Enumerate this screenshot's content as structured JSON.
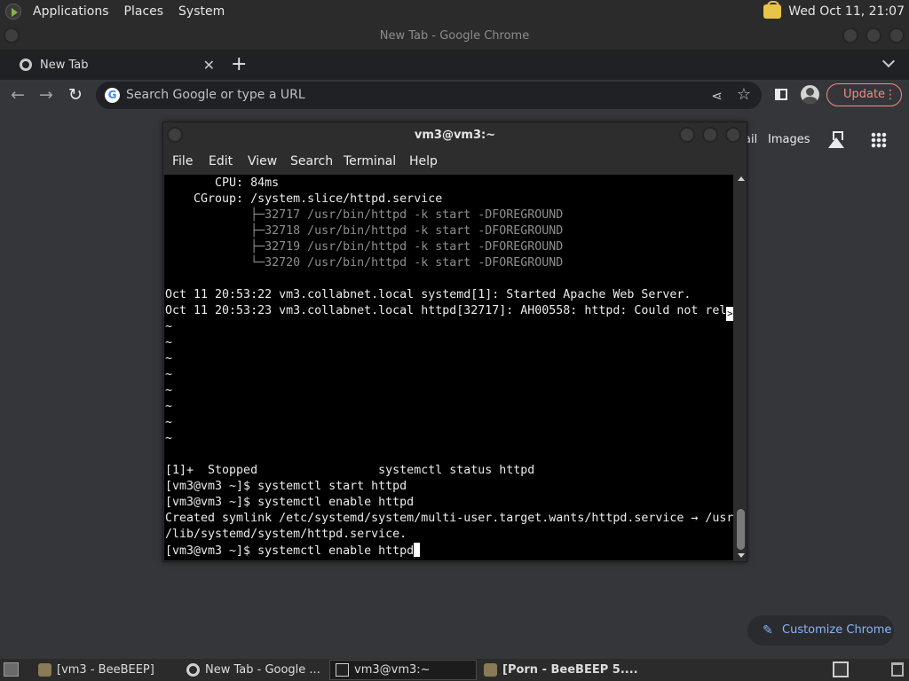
{
  "top_panel": {
    "menus": [
      "Applications",
      "Places",
      "System"
    ],
    "clock": "Wed Oct 11, 21:07"
  },
  "chrome": {
    "window_title": "New Tab - Google Chrome",
    "tab_label": "New Tab",
    "omnibox_placeholder": "Search Google or type a URL",
    "update_label": "Update",
    "gmail_label": "ail",
    "images_label": "Images",
    "customize_label": "Customize Chrome"
  },
  "terminal": {
    "title": "vm3@vm3:~",
    "menus": [
      "File",
      "Edit",
      "View",
      "Search",
      "Terminal",
      "Help"
    ],
    "lines": [
      {
        "text": "       CPU: 84ms",
        "dim": false
      },
      {
        "text": "    CGroup: /system.slice/httpd.service",
        "dim": false
      },
      {
        "text": "            ├─32717 /usr/bin/httpd -k start -DFOREGROUND",
        "dim": true
      },
      {
        "text": "            ├─32718 /usr/bin/httpd -k start -DFOREGROUND",
        "dim": true
      },
      {
        "text": "            ├─32719 /usr/bin/httpd -k start -DFOREGROUND",
        "dim": true
      },
      {
        "text": "            └─32720 /usr/bin/httpd -k start -DFOREGROUND",
        "dim": true
      },
      {
        "text": "",
        "dim": false
      },
      {
        "text": "Oct 11 20:53:22 vm3.collabnet.local systemd[1]: Started Apache Web Server.",
        "dim": false
      },
      {
        "text": "Oct 11 20:53:23 vm3.collabnet.local httpd[32717]: AH00558: httpd: Could not rel",
        "dim": false,
        "truncated": true
      },
      {
        "text": "~",
        "dim": false
      },
      {
        "text": "~",
        "dim": false
      },
      {
        "text": "~",
        "dim": false
      },
      {
        "text": "~",
        "dim": false
      },
      {
        "text": "~",
        "dim": false
      },
      {
        "text": "~",
        "dim": false
      },
      {
        "text": "~",
        "dim": false
      },
      {
        "text": "~",
        "dim": false
      },
      {
        "text": "",
        "dim": false
      },
      {
        "text": "[1]+  Stopped                 systemctl status httpd",
        "dim": false
      },
      {
        "text": "[vm3@vm3 ~]$ systemctl start httpd",
        "dim": false
      },
      {
        "text": "[vm3@vm3 ~]$ systemctl enable httpd",
        "dim": false
      },
      {
        "text": "Created symlink /etc/systemd/system/multi-user.target.wants/httpd.service → /usr",
        "dim": false
      },
      {
        "text": "/lib/systemd/system/httpd.service.",
        "dim": false
      },
      {
        "text": "[vm3@vm3 ~]$ systemctl enable httpd",
        "dim": false,
        "cursor": true
      }
    ]
  },
  "taskbar": {
    "tasks": [
      {
        "label": "[vm3 - BeeBEEP]",
        "icon": "beebeep-icon",
        "active": false,
        "bold": false
      },
      {
        "label": "New Tab - Google ...",
        "icon": "chrome-icon",
        "active": false,
        "bold": false
      },
      {
        "label": "vm3@vm3:~",
        "icon": "terminal-icon",
        "active": true,
        "bold": false
      },
      {
        "label": "[Porn - BeeBEEP 5....",
        "icon": "beebeep-icon",
        "active": false,
        "bold": true
      }
    ]
  }
}
